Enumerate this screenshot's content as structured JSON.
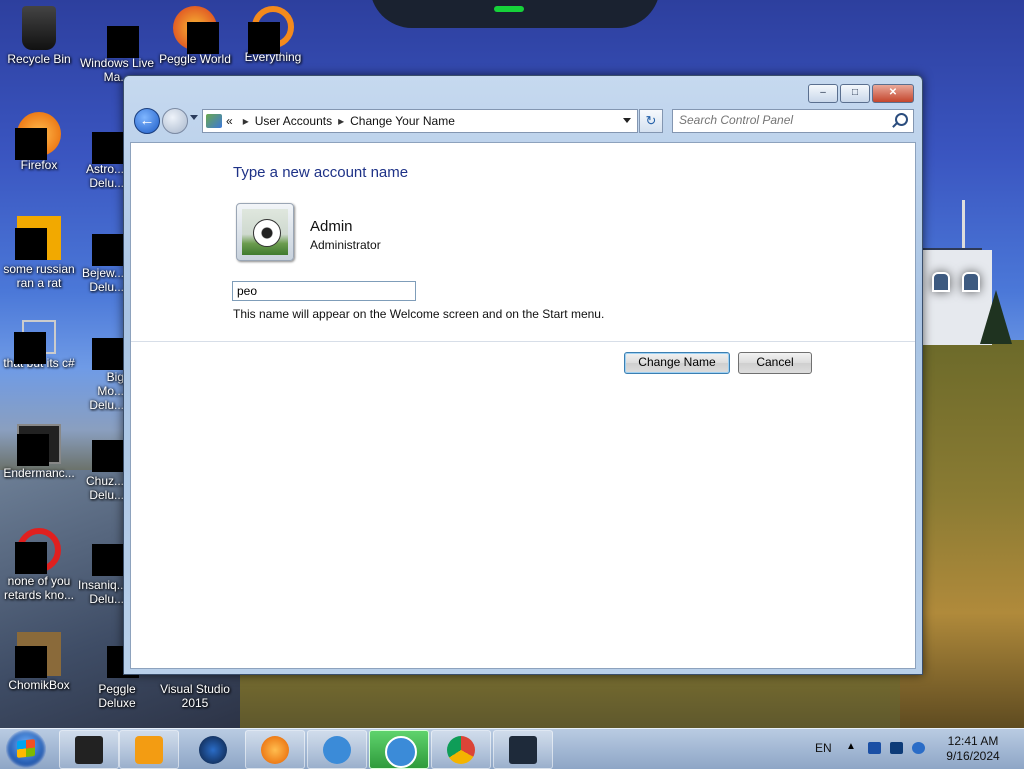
{
  "desktop": {
    "icons": [
      {
        "label": "Recycle Bin"
      },
      {
        "label": "Windows Live Ma..."
      },
      {
        "label": "Peggle World"
      },
      {
        "label": "Everything"
      },
      {
        "label": "Firefox"
      },
      {
        "label": "Astro... Delu..."
      },
      {
        "label": "some russian ran a rat"
      },
      {
        "label": "Bejew... Delu..."
      },
      {
        "label": "that but its c#"
      },
      {
        "label": "Big Mo... Delu..."
      },
      {
        "label": "Endermanc..."
      },
      {
        "label": "Chuz... Delu..."
      },
      {
        "label": "none of you retards kno..."
      },
      {
        "label": "Insaniq... Delu..."
      },
      {
        "label": "ChomikBox"
      },
      {
        "label": "Peggle Deluxe"
      },
      {
        "label": "Visual Studio 2015"
      }
    ]
  },
  "window": {
    "controls": {
      "minimize": "–",
      "maximize": "□",
      "close": "✕"
    },
    "address": {
      "prefix": "«",
      "crumbs": [
        "User Accounts",
        "Change Your Name"
      ],
      "separator": "▸"
    },
    "refresh_glyph": "↻",
    "search": {
      "placeholder": "Search Control Panel"
    },
    "content": {
      "heading": "Type a new account name",
      "user": {
        "name": "Admin",
        "role": "Administrator"
      },
      "name_input": {
        "value": "peo"
      },
      "hint": "This name will appear on the Welcome screen and on the Start menu.",
      "buttons": {
        "change": "Change Name",
        "cancel": "Cancel"
      }
    }
  },
  "taskbar": {
    "apps": [
      "file-explorer",
      "media-player",
      "globe",
      "firefox",
      "simplenote",
      "simplenote-active",
      "chrome",
      "monitor"
    ],
    "tray": {
      "language": "EN",
      "time": "12:41 AM",
      "date": "9/16/2024"
    }
  },
  "colors": {
    "heading": "#1e3287",
    "taskbar": "#a3b8d4",
    "button_focus": "#3c7fb1"
  }
}
